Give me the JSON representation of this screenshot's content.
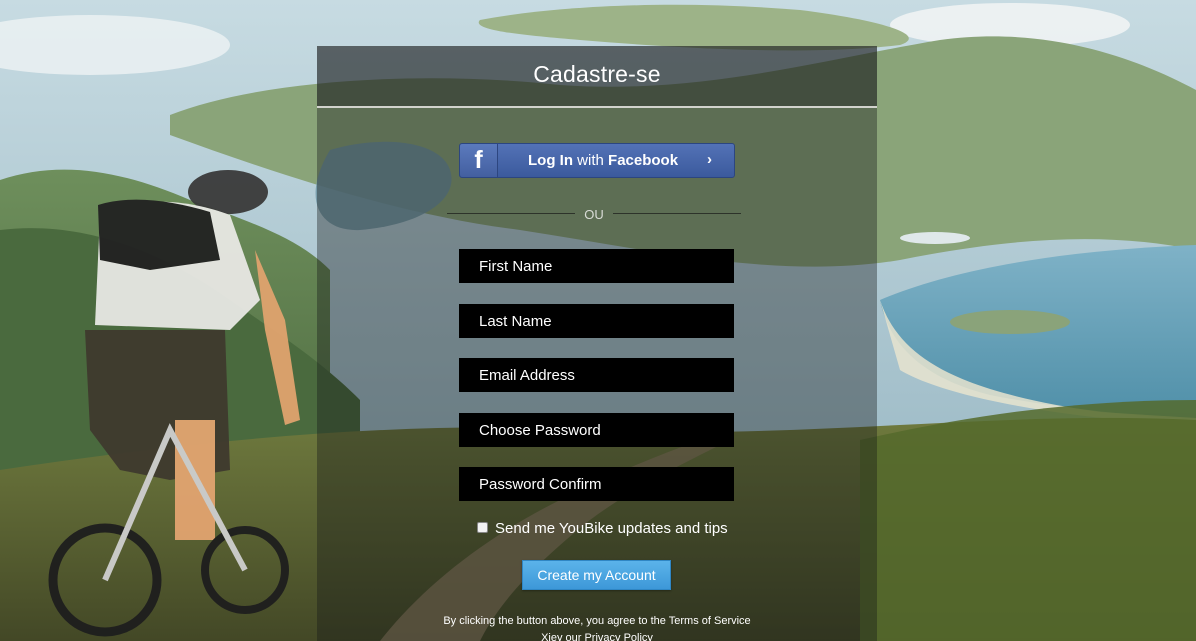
{
  "form": {
    "title": "Cadastre-se",
    "facebook": {
      "icon": "facebook-icon",
      "prefix": "Log In",
      "middle": "with",
      "brand": "Facebook",
      "chevron": "›",
      "color": "#3b5998"
    },
    "separator": "OU",
    "fields": {
      "first_name": "First Name",
      "last_name": "Last Name",
      "email": "Email Address",
      "password": "Choose Password",
      "password_confirm": "Password Confirm"
    },
    "newsletter_label": "Send me YouBike updates and tips",
    "newsletter_checked": false,
    "submit_label": "Create my Account",
    "submit_color": "#4aa7e3",
    "terms_text": "By clicking the button above, you agree to the Terms of Service Xiey our Privacy Policy"
  }
}
